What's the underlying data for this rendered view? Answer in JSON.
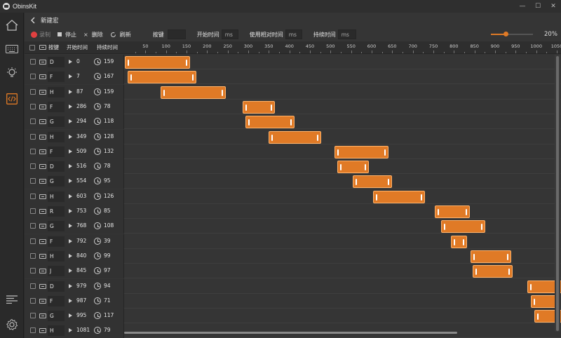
{
  "app": {
    "title": "ObinsKit"
  },
  "window": {
    "minimize": "—",
    "maximize": "☐",
    "close": "✕"
  },
  "sidebar": {
    "items": [
      {
        "icon": "home-icon"
      },
      {
        "icon": "keyboard-icon"
      },
      {
        "icon": "lightbulb-icon"
      },
      {
        "icon": "macro-code-icon",
        "active": true
      },
      {
        "icon": "list-icon"
      },
      {
        "icon": "settings-gear-icon"
      }
    ]
  },
  "header": {
    "title": "新建宏"
  },
  "toolbar": {
    "record_label": "录制",
    "stop_label": "停止",
    "delete_label": "删除",
    "refresh_label": "刷新",
    "key_label": "按键",
    "key_value": "",
    "start_label": "开始时间",
    "start_unit": "ms",
    "relative_label": "使用相对时间",
    "relative_unit": "ms",
    "duration_label": "持续时间",
    "duration_unit": "ms",
    "zoom_value": "20%",
    "zoom_fraction": 0.35
  },
  "columns": {
    "key": "按键",
    "start": "开始时间",
    "duration": "持续时间"
  },
  "timeline": {
    "start": 0,
    "ticks": [
      50,
      100,
      150,
      200,
      250,
      300,
      350,
      400,
      450,
      500,
      550,
      600,
      650,
      700,
      750,
      800,
      850,
      900,
      950,
      1000,
      1050
    ]
  },
  "events": [
    {
      "key": "D",
      "start": "0",
      "duration": "159"
    },
    {
      "key": "F",
      "start": "7",
      "duration": "167"
    },
    {
      "key": "H",
      "start": "87",
      "duration": "159"
    },
    {
      "key": "F",
      "start": "286",
      "duration": "78"
    },
    {
      "key": "G",
      "start": "294",
      "duration": "118"
    },
    {
      "key": "H",
      "start": "349",
      "duration": "128"
    },
    {
      "key": "F",
      "start": "509",
      "duration": "132"
    },
    {
      "key": "D",
      "start": "516",
      "duration": "78"
    },
    {
      "key": "G",
      "start": "554",
      "duration": "95"
    },
    {
      "key": "H",
      "start": "603",
      "duration": "126"
    },
    {
      "key": "R",
      "start": "753",
      "duration": "85"
    },
    {
      "key": "G",
      "start": "768",
      "duration": "108"
    },
    {
      "key": "F",
      "start": "792",
      "duration": "39"
    },
    {
      "key": "H",
      "start": "840",
      "duration": "99"
    },
    {
      "key": "J",
      "start": "845",
      "duration": "97"
    },
    {
      "key": "D",
      "start": "979",
      "duration": "94"
    },
    {
      "key": "F",
      "start": "987",
      "duration": "71"
    },
    {
      "key": "G",
      "start": "995",
      "duration": "117"
    },
    {
      "key": "H",
      "start": "1081",
      "duration": "79"
    }
  ],
  "colors": {
    "accent": "#e07a26",
    "record": "#e04040",
    "background": "#353535"
  }
}
